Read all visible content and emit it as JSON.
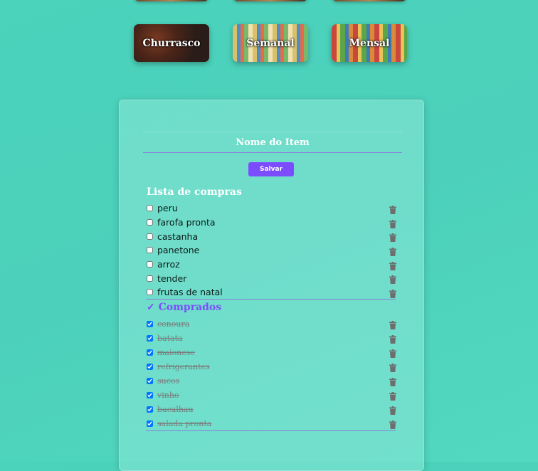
{
  "categories": [
    {
      "label": "Churrasco"
    },
    {
      "label": "Semanal"
    },
    {
      "label": "Mensal"
    }
  ],
  "form": {
    "item_placeholder": "Nome do Item",
    "save_label": "Salvar"
  },
  "shopping_list": {
    "title": "Lista de compras",
    "items": [
      "peru",
      "farofa pronta",
      "castanha",
      "panetone",
      "arroz",
      "tender",
      "frutas de natal"
    ]
  },
  "purchased": {
    "title": "✓ Comprados",
    "items": [
      "cenoura",
      "batata",
      "maionese",
      "refrigerantes",
      "sucos",
      "vinho",
      "bacalhau",
      "salada pronta"
    ]
  },
  "colors": {
    "accent": "#7c4dff",
    "background": "#4bd3bc",
    "trash_icon": "#6e6e6e"
  }
}
